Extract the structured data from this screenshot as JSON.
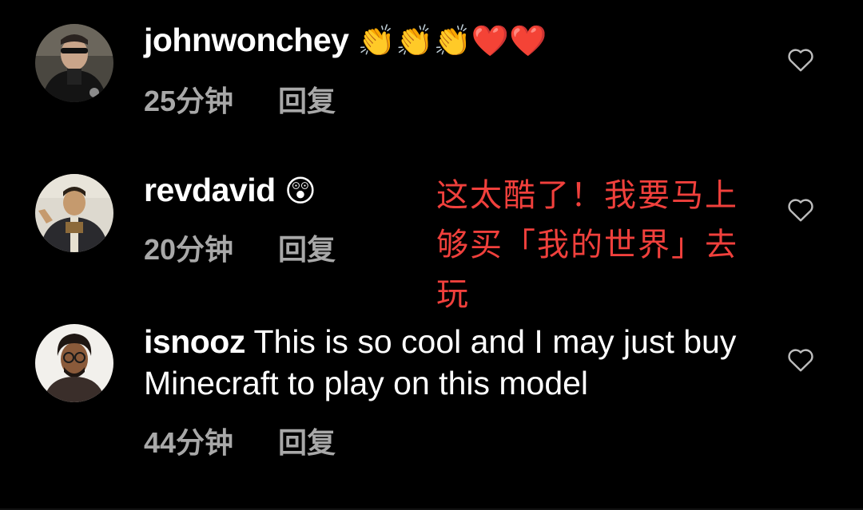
{
  "comments": [
    {
      "username": "johnwonchey",
      "text": "",
      "emoji": "👏👏👏❤️❤️",
      "time": "25分钟",
      "reply_label": "回复",
      "avatar_icon": "avatar-man-sunglasses"
    },
    {
      "username": "revdavid",
      "text": "",
      "emoji": "😲",
      "time": "20分钟",
      "reply_label": "回复",
      "avatar_icon": "avatar-man-robe"
    },
    {
      "username": "isnooz",
      "text": " This is so cool and I may just buy Minecraft to play on this model",
      "emoji": "",
      "time": "44分钟",
      "reply_label": "回复",
      "avatar_icon": "avatar-man-glasses"
    }
  ],
  "annotation": {
    "text": "这太酷了！我要马上够买「我的世界」去玩",
    "color": "#f0403c"
  },
  "icons": {
    "like": "heart-outline-icon"
  },
  "colors": {
    "background": "#000000",
    "meta": "#a8a8a8",
    "text": "#ffffff"
  }
}
